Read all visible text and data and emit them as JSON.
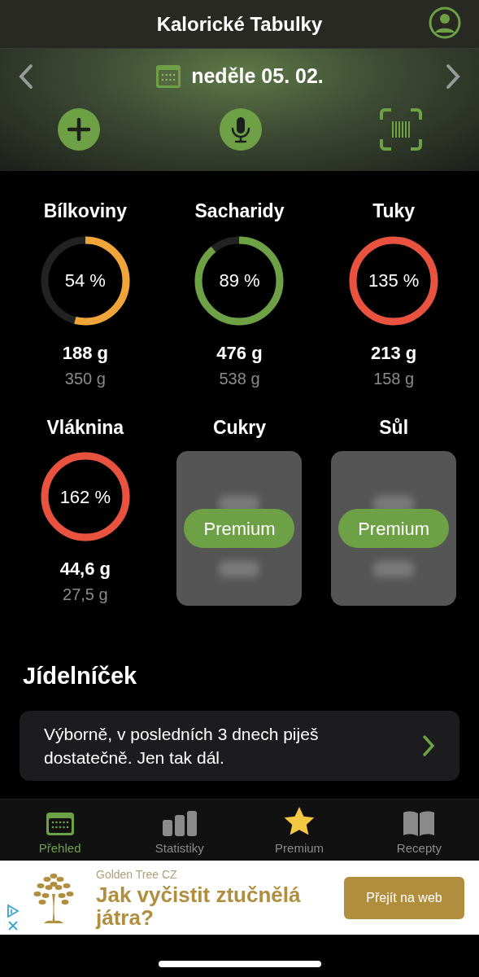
{
  "header": {
    "title": "Kalorické Tabulky"
  },
  "date_bar": {
    "date": "neděle 05. 02."
  },
  "nutrients": [
    {
      "kind": "ring",
      "name": "Bílkoviny",
      "percent": "54 %",
      "color": "#f0a53a",
      "amount": "188 g",
      "goal": "350 g"
    },
    {
      "kind": "ring",
      "name": "Sacharidy",
      "percent": "89 %",
      "color": "#6ea045",
      "amount": "476 g",
      "goal": "538 g"
    },
    {
      "kind": "ring",
      "name": "Tuky",
      "percent": "135 %",
      "color": "#e8523f",
      "amount": "213 g",
      "goal": "158 g"
    },
    {
      "kind": "ring",
      "name": "Vláknina",
      "percent": "162 %",
      "color": "#e8523f",
      "amount": "44,6 g",
      "goal": "27,5 g"
    },
    {
      "kind": "locked",
      "name": "Cukry",
      "button": "Premium"
    },
    {
      "kind": "locked",
      "name": "Sůl",
      "button": "Premium"
    }
  ],
  "menu_section": {
    "title": "Jídelníček",
    "message": "Výborně, v posledních 3 dnech piješ dostatečně. Jen tak dál."
  },
  "tabs": [
    {
      "kind": "calendar",
      "label": "Přehled",
      "selected": true
    },
    {
      "kind": "chart",
      "label": "Statistiky",
      "selected": false
    },
    {
      "kind": "star",
      "label": "Premium",
      "selected": false
    },
    {
      "kind": "book",
      "label": "Recepty",
      "selected": false
    }
  ],
  "ad": {
    "advertiser": "Golden Tree CZ",
    "headline": "Jak vyčistit ztučnělá játra?",
    "button": "Přejít na web"
  }
}
